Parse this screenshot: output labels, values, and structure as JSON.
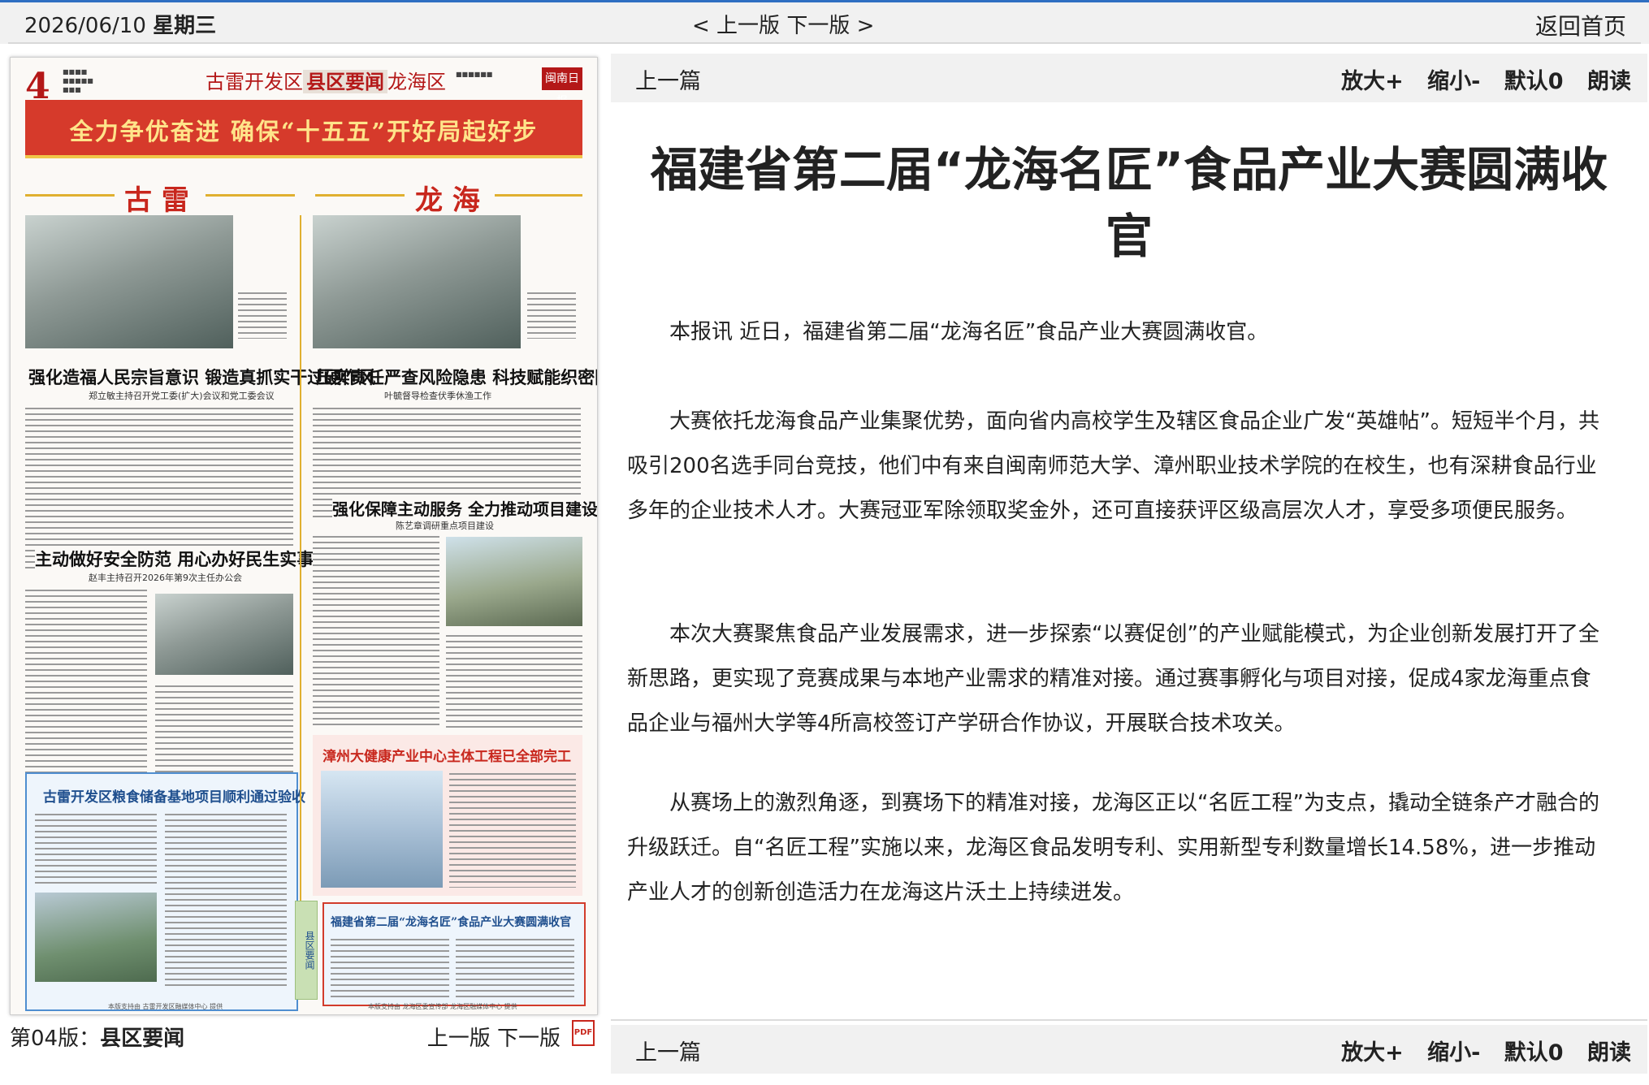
{
  "topbar": {
    "date": "2026/06/10",
    "weekday": "星期三",
    "prev_edition": "< 上一版",
    "next_edition": "下一版 >",
    "home": "返回首页"
  },
  "paper": {
    "page_number": "4",
    "header_left": "古雷开发区",
    "header_middle": "县区要闻",
    "header_right": "龙海区",
    "masthead": "闽南日报",
    "banner": "全力争优奋进 确保“十五五”开好局起好步",
    "left_section": "古 雷",
    "right_section": "龙 海",
    "headline_1": "强化造福人民宗旨意识 锻造真抓实干过硬作风",
    "sub_1": "郑立敏主持召开党工委(扩大)会议和党工委会议",
    "headline_2": "压实责任严查风险隐患 科技赋能织密防控体系",
    "sub_2": "叶毓督导检查伏季休渔工作",
    "headline_3": "强化保障主动服务 全力推动项目建设",
    "sub_3": "陈艺章调研重点项目建设",
    "headline_4": "主动做好安全防范 用心办好民生实事",
    "sub_4": "赵丰主持召开2026年第9次主任办公会",
    "box_left_title": "古雷开发区粮食储备基地项目顺利通过验收",
    "box_right_title": "漳州大健康产业中心主体工程已全部完工",
    "box_highlight_title": "福建省第二届“龙海名匠”食品产业大赛圆满收官",
    "vertical_tag": "县区要闻",
    "footer_left": "本版支持由 古雷开发区融媒体中心 提供",
    "footer_right": "本版支持由 龙海区委宣传部 龙海区融媒体中心 提供"
  },
  "edition_bar": {
    "label": "第04版：",
    "name": "县区要闻",
    "prev": "上一版",
    "next": "下一版",
    "pdf_icon": "pdf-icon"
  },
  "article_toolbar": {
    "prev_article": "上一篇",
    "zoom_in": "放大+",
    "zoom_out": "缩小-",
    "default": "默认0",
    "read": "朗读"
  },
  "article": {
    "title": "福建省第二届“龙海名匠”食品产业大赛圆满收官",
    "paragraphs": [
      "本报讯 近日，福建省第二届“龙海名匠”食品产业大赛圆满收官。",
      "大赛依托龙海食品产业集聚优势，面向省内高校学生及辖区食品企业广发“英雄帖”。短短半个月，共吸引200名选手同台竞技，他们中有来自闽南师范大学、漳州职业技术学院的在校生，也有深耕食品行业多年的企业技术人才。大赛冠亚军除领取奖金外，还可直接获评区级高层次人才，享受多项便民服务。",
      "本次大赛聚焦食品产业发展需求，进一步探索“以赛促创”的产业赋能模式，为企业创新发展打开了全新思路，更实现了竞赛成果与本地产业需求的精准对接。通过赛事孵化与项目对接，促成4家龙海重点食品企业与福州大学等4所高校签订产学研合作协议，开展联合技术攻关。",
      "从赛场上的激烈角逐，到赛场下的精准对接，龙海区正以“名匠工程”为支点，撬动全链条产才融合的升级跃迁。自“名匠工程”实施以来，龙海区食品发明专利、实用新型专利数量增长14.58%，进一步推动产业人才的创新创造活力在龙海这片沃土上持续迸发。"
    ]
  },
  "colors": {
    "accent_red": "#c8271d",
    "accent_blue": "#2f6fc2",
    "toolbar_bg": "#f1f1f1"
  }
}
